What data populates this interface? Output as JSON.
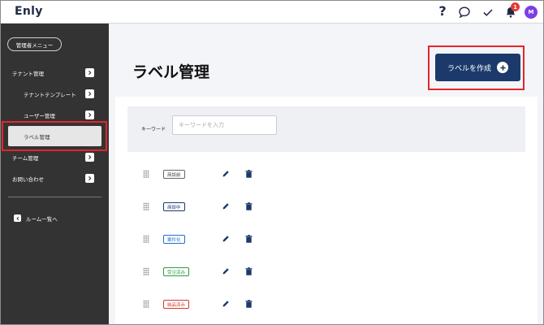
{
  "header": {
    "logo": "Enly",
    "help_icon": "?",
    "notification_count": "1",
    "avatar_initial": "M",
    "icons": [
      "help-icon",
      "chat-icon",
      "check-icon",
      "bell-icon"
    ]
  },
  "sidebar": {
    "admin_menu": "管理者メニュー",
    "items": [
      {
        "label": "テナント管理"
      },
      {
        "label": "テナントテンプレート"
      },
      {
        "label": "ユーザー管理"
      },
      {
        "label": "ラベル管理",
        "active": true
      },
      {
        "label": "チーム管理"
      },
      {
        "label": "お問い合わせ"
      }
    ],
    "room_list": "ルーム一覧へ"
  },
  "main": {
    "title": "ラベル管理",
    "create_button": "ラベルを作成",
    "search": {
      "label": "キーワード",
      "placeholder": "キーワードを入力"
    },
    "labels": [
      {
        "name": "商談前",
        "color": "#444444"
      },
      {
        "name": "商談中",
        "color": "#1b3a6b"
      },
      {
        "name": "案件化",
        "color": "#1e6fd0"
      },
      {
        "name": "受注済み",
        "color": "#2e9a3c"
      },
      {
        "name": "納品済み",
        "color": "#d23b2c"
      }
    ]
  },
  "colors": {
    "sidebar_bg": "#333333",
    "primary": "#1b3a6b",
    "highlight": "#e3262b"
  }
}
